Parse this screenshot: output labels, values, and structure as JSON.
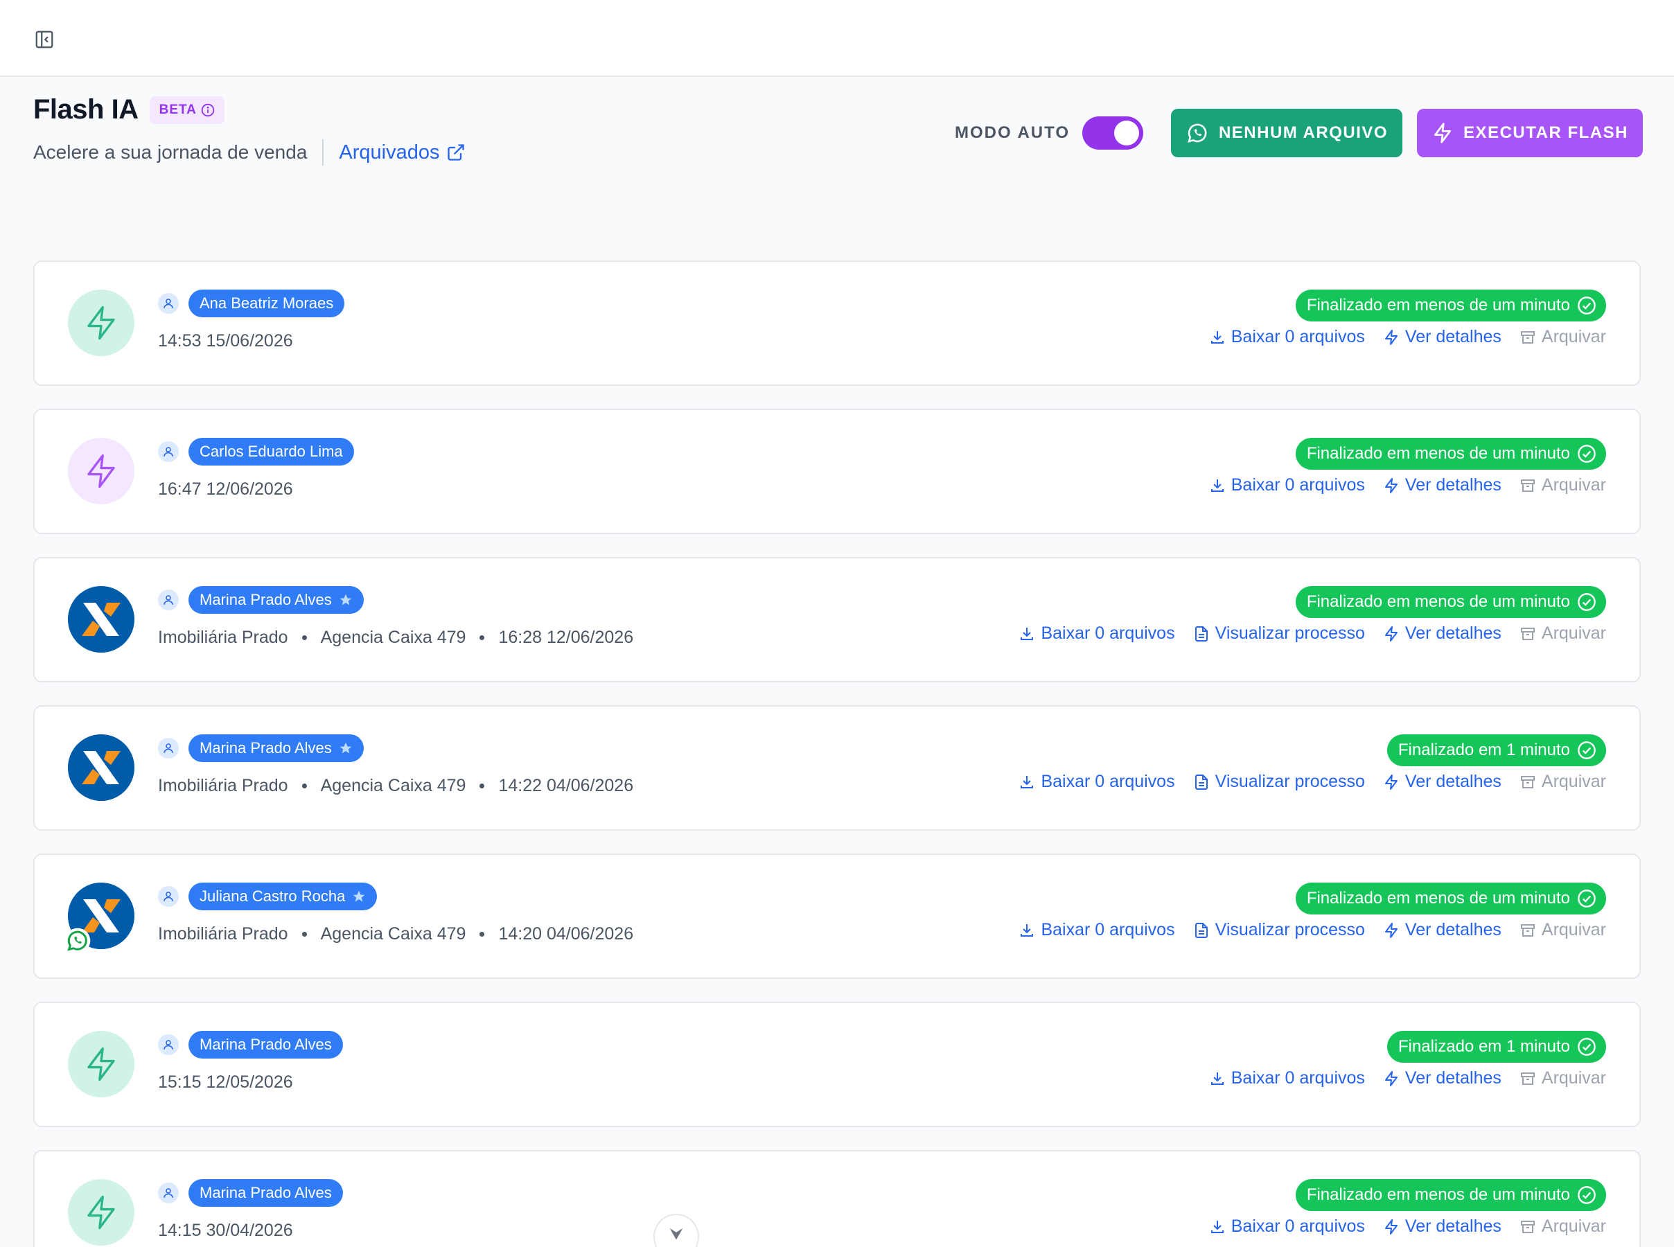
{
  "page": {
    "title": "Flash IA",
    "badge": "BETA",
    "subtitle": "Acelere a sua jornada de venda",
    "archived_link": "Arquivados"
  },
  "actions": {
    "mode_label": "MODO AUTO",
    "mode_auto_on": true,
    "whatsapp_button": "NENHUM ARQUIVO",
    "execute_button": "EXECUTAR FLASH"
  },
  "colors": {
    "primary_purple": "#a855f7",
    "whatsapp_green": "#1aa37a",
    "status_green": "#16c55a",
    "link_blue": "#2563eb",
    "name_pill": "#2f7cf6"
  },
  "labels": {
    "download": "Baixar 0 arquivos",
    "view_process": "Visualizar processo",
    "details": "Ver detalhes",
    "archive": "Arquivar"
  },
  "items": [
    {
      "name": "Ana Beatriz Moraes",
      "starred": false,
      "avatar": "flash-green",
      "meta": [
        "14:53 15/06/2026"
      ],
      "status": "Finalizado em menos de um minuto",
      "has_process": false
    },
    {
      "name": "Carlos Eduardo Lima",
      "starred": false,
      "avatar": "flash-purple",
      "meta": [
        "16:47 12/06/2026"
      ],
      "status": "Finalizado em menos de um minuto",
      "has_process": false
    },
    {
      "name": "Marina Prado Alves",
      "starred": true,
      "avatar": "caixa",
      "meta": [
        "Imobiliária Prado",
        "Agencia Caixa 479",
        "16:28 12/06/2026"
      ],
      "status": "Finalizado em menos de um minuto",
      "has_process": true
    },
    {
      "name": "Marina Prado Alves",
      "starred": true,
      "avatar": "caixa",
      "meta": [
        "Imobiliária Prado",
        "Agencia Caixa 479",
        "14:22 04/06/2026"
      ],
      "status": "Finalizado em 1 minuto",
      "has_process": true
    },
    {
      "name": "Juliana Castro Rocha",
      "starred": true,
      "avatar": "caixa-whatsapp",
      "meta": [
        "Imobiliária Prado",
        "Agencia Caixa 479",
        "14:20 04/06/2026"
      ],
      "status": "Finalizado em menos de um minuto",
      "has_process": true
    },
    {
      "name": "Marina Prado Alves",
      "starred": false,
      "avatar": "flash-green",
      "meta": [
        "15:15 12/05/2026"
      ],
      "status": "Finalizado em 1 minuto",
      "has_process": false
    },
    {
      "name": "Marina Prado Alves",
      "starred": false,
      "avatar": "flash-green",
      "meta": [
        "14:15 30/04/2026"
      ],
      "status": "Finalizado em menos de um minuto",
      "has_process": false
    }
  ]
}
